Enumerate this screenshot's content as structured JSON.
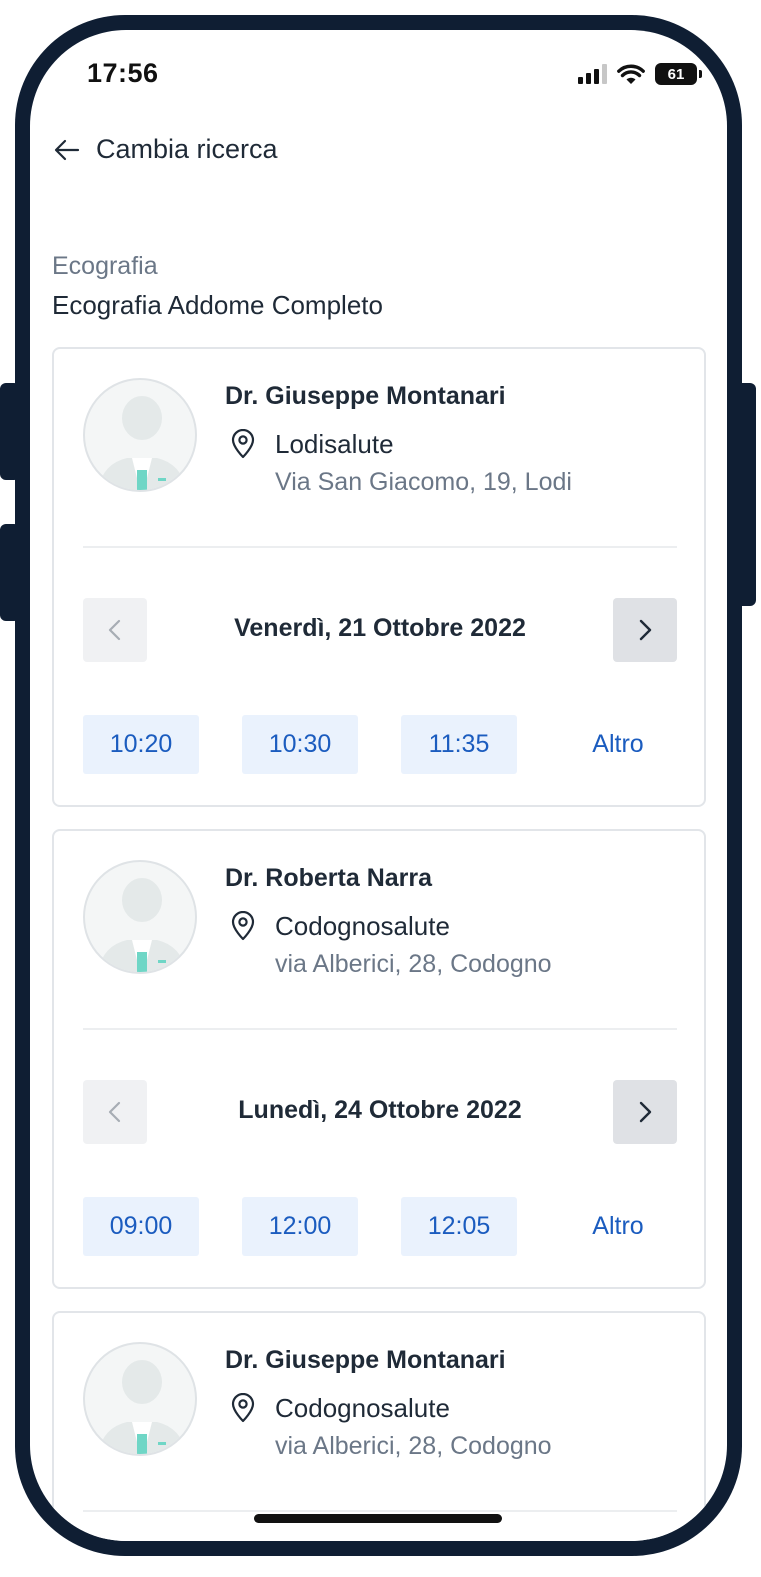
{
  "status_bar": {
    "time": "17:56",
    "battery": "61"
  },
  "nav": {
    "back_label": "Cambia ricerca"
  },
  "section": {
    "category": "Ecografia",
    "title": "Ecografia Addome Completo"
  },
  "results": [
    {
      "doctor": "Dr. Giuseppe Montanari",
      "clinic": "Lodisalute",
      "address": "Via San Giacomo, 19, Lodi",
      "date": "Venerdì, 21 Ottobre 2022",
      "slots": [
        "10:20",
        "10:30",
        "11:35"
      ],
      "more_label": "Altro"
    },
    {
      "doctor": "Dr. Roberta Narra",
      "clinic": "Codognosalute",
      "address": "via Alberici, 28, Codogno",
      "date": "Lunedì, 24 Ottobre 2022",
      "slots": [
        "09:00",
        "12:00",
        "12:05"
      ],
      "more_label": "Altro"
    },
    {
      "doctor": "Dr. Giuseppe Montanari",
      "clinic": "Codognosalute",
      "address": "via Alberici, 28, Codogno"
    }
  ],
  "colors": {
    "frame": "#0f1e33",
    "accent": "#1b5cbf",
    "slot_bg": "#eaf2fd",
    "muted_text": "#6b7787"
  }
}
